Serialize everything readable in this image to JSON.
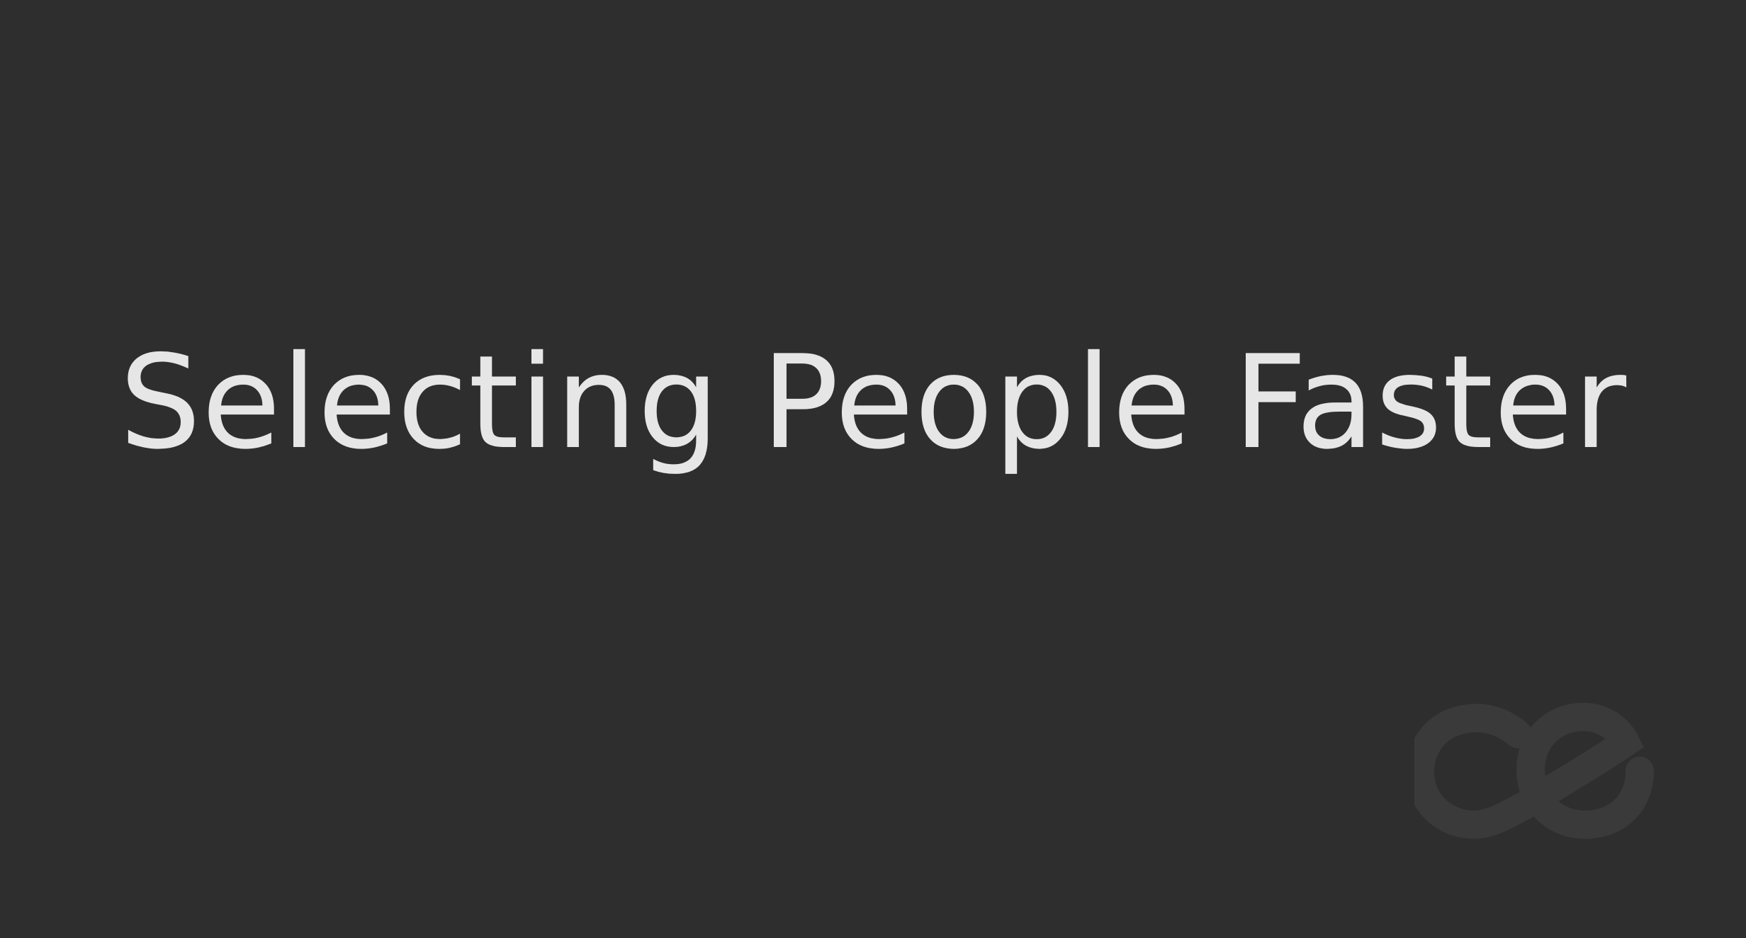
{
  "slide": {
    "title": "Selecting People Faster",
    "background_color": "#2e2e2e",
    "title_color": "#e6e6e6"
  },
  "logo": {
    "icon": "ce-logo-icon",
    "color": "#3a3a3a"
  }
}
